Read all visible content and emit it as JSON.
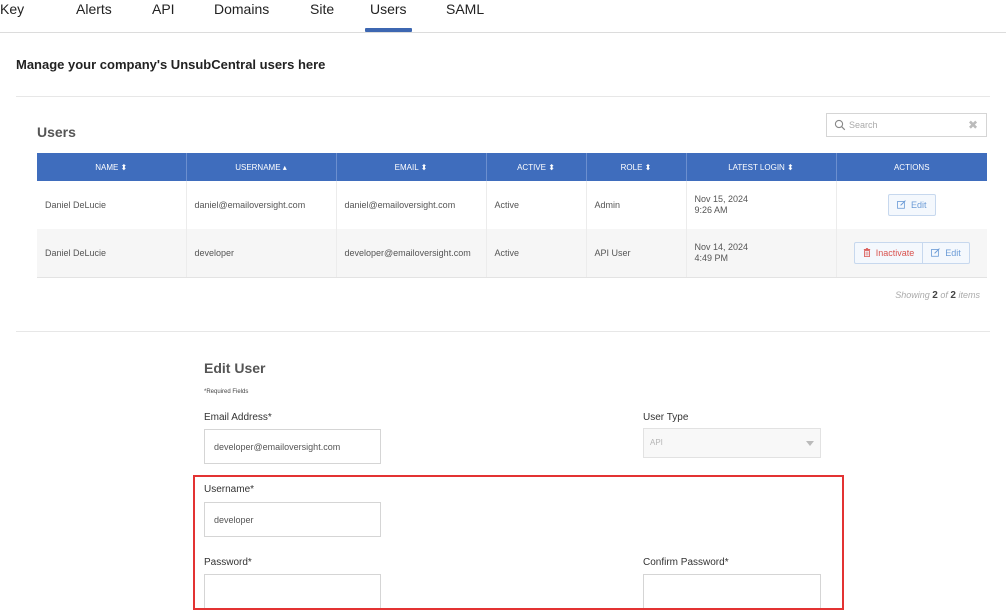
{
  "tabs": [
    {
      "label": "Key",
      "active": false
    },
    {
      "label": "Alerts",
      "active": false
    },
    {
      "label": "API",
      "active": false
    },
    {
      "label": "Domains",
      "active": false
    },
    {
      "label": "Site",
      "active": false
    },
    {
      "label": "Users",
      "active": true
    },
    {
      "label": "SAML",
      "active": false
    }
  ],
  "page_title": "Manage your company's UnsubCentral users here",
  "users_section": {
    "heading": "Users",
    "search": {
      "placeholder": "Search",
      "value": ""
    },
    "columns": [
      "NAME ⬍",
      "USERNAME ▴",
      "EMAIL ⬍",
      "ACTIVE ⬍",
      "ROLE ⬍",
      "LATEST LOGIN ⬍",
      "ACTIONS"
    ],
    "rows": [
      {
        "name": "Daniel DeLucie",
        "username": "daniel@emailoversight.com",
        "email": "daniel@emailoversight.com",
        "active": "Active",
        "role": "Admin",
        "login_date": "Nov 15, 2024",
        "login_time": "9:26 AM",
        "edit_label": "Edit"
      },
      {
        "name": "Daniel DeLucie",
        "username": "developer",
        "email": "developer@emailoversight.com",
        "active": "Active",
        "role": "API User",
        "login_date": "Nov 14, 2024",
        "login_time": "4:49 PM",
        "inactivate_label": "Inactivate",
        "edit_label": "Edit"
      }
    ],
    "showing": {
      "prefix": "Showing",
      "shown": "2",
      "of": "of",
      "total": "2",
      "suffix": "items"
    }
  },
  "edit_user": {
    "title": "Edit User",
    "required_note": "*Required Fields",
    "email_label": "Email Address*",
    "email_value": "developer@emailoversight.com",
    "user_type_label": "User Type",
    "user_type_value": "API",
    "username_label": "Username*",
    "username_value": "developer",
    "password_label": "Password*",
    "password_value": "",
    "confirm_password_label": "Confirm Password*",
    "confirm_password_value": ""
  },
  "colors": {
    "header_blue": "#3f6dbd",
    "tab_underline": "#3d67b1",
    "highlight_red": "#e33333",
    "danger_red": "#d9534f"
  }
}
